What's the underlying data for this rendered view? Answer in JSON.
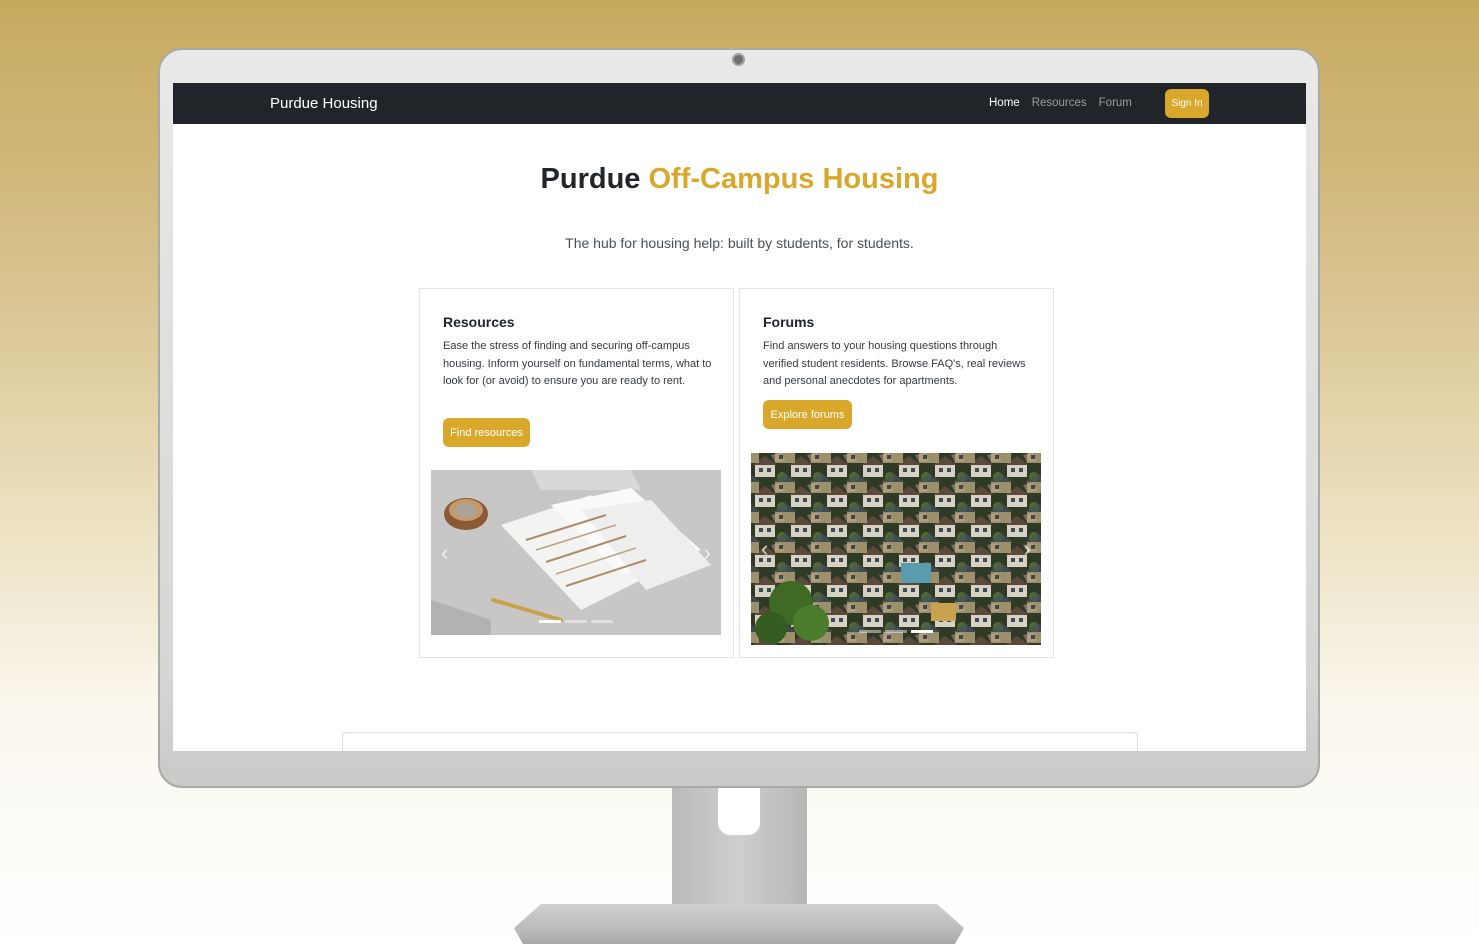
{
  "navbar": {
    "brand": "Purdue Housing",
    "links": [
      {
        "label": "Home",
        "active": true
      },
      {
        "label": "Resources",
        "active": false
      },
      {
        "label": "Forum",
        "active": false
      }
    ],
    "sign_in_label": "Sign In"
  },
  "hero": {
    "title_plain": "Purdue",
    "title_accent": "Off-Campus Housing",
    "subtitle": "The hub for housing help: built by students, for students."
  },
  "cards": [
    {
      "title": "Resources",
      "text": "Ease the stress of finding and securing off-campus housing. Inform yourself on fundamental terms, what to look for (or avoid) to ensure you are ready to rent.",
      "button": "Find resources",
      "image": "documents-and-pen-photo",
      "active_slide": 1
    },
    {
      "title": "Forums",
      "text": "Find answers to your housing questions through verified student residents. Browse FAQ's, real reviews and personal anecdotes for apartments.",
      "button": "Explore forums",
      "image": "aerial-houses-photo",
      "active_slide": 3
    }
  ],
  "colors": {
    "accent": "#d9a82a",
    "navbar": "#212529",
    "text": "#212529"
  },
  "icons": {
    "prev": "chevron-left-icon",
    "next": "chevron-right-icon"
  }
}
